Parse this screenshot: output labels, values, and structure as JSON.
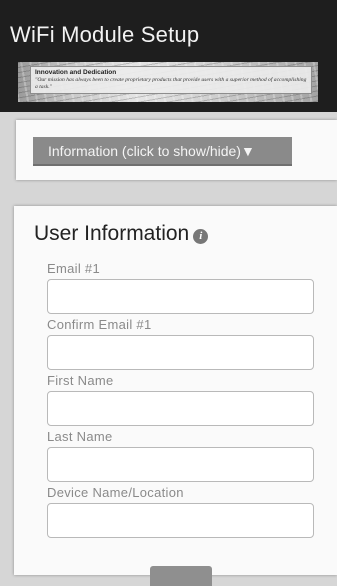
{
  "header": {
    "title": "WiFi Module Setup",
    "banner": {
      "heading": "Innovation and Dedication",
      "quote": "\"Our mission has always been to create proprietary products that provide users with a superior method of accomplishing a task.\""
    }
  },
  "info_panel": {
    "toggle_label": "Information (click to show/hide)▼"
  },
  "user_form": {
    "title": "User Information",
    "info_icon": "i",
    "fields": [
      {
        "label": "Email #1",
        "value": ""
      },
      {
        "label": "Confirm Email #1",
        "value": ""
      },
      {
        "label": "First Name",
        "value": ""
      },
      {
        "label": "Last Name",
        "value": ""
      },
      {
        "label": "Device Name/Location",
        "value": ""
      }
    ]
  }
}
